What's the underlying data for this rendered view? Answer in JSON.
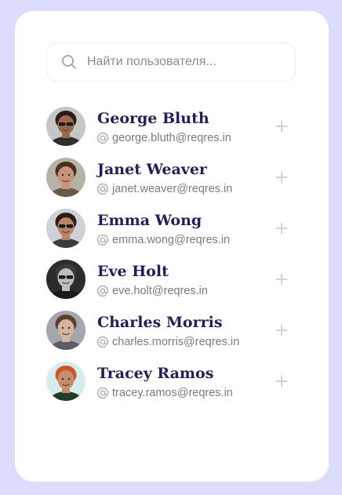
{
  "search": {
    "placeholder": "Найти пользователя..."
  },
  "users": [
    {
      "name": "George Bluth",
      "email": "george.bluth@reqres.in",
      "skin": "#9a6a4c",
      "hair": "#2a1d17",
      "bg": "#c6c6c6",
      "shirt": "#2f2f2f",
      "glasses": true
    },
    {
      "name": "Janet Weaver",
      "email": "janet.weaver@reqres.in",
      "skin": "#c99478",
      "hair": "#4a2f1e",
      "bg": "#b5b2a8",
      "shirt": "#6b5846",
      "glasses": false
    },
    {
      "name": "Emma Wong",
      "email": "emma.wong@reqres.in",
      "skin": "#b88469",
      "hair": "#2b1e18",
      "bg": "#cfd1d6",
      "shirt": "#3a3a3a",
      "glasses": true
    },
    {
      "name": "Eve Holt",
      "email": "eve.holt@reqres.in",
      "skin": "#bdbdbd",
      "hair": "#3a3a3a",
      "bg": "#2c2c2c",
      "shirt": "#1a1a1a",
      "glasses": true
    },
    {
      "name": "Charles Morris",
      "email": "charles.morris@reqres.in",
      "skin": "#d5b4a0",
      "hair": "#5b4030",
      "bg": "#a4a6ae",
      "shirt": "#5c5e66",
      "glasses": false
    },
    {
      "name": "Tracey Ramos",
      "email": "tracey.ramos@reqres.in",
      "skin": "#c88d6b",
      "hair": "#c9572c",
      "bg": "#d7ecec",
      "shirt": "#1f3b2a",
      "glasses": false
    }
  ],
  "colors": {
    "page_background": "#dcdcfd",
    "card_background": "#ffffff",
    "name_text": "#221e57",
    "email_text": "#7a7a80",
    "icon_muted": "#b0b0b6",
    "add_icon": "#d2d2d8"
  },
  "icons": {
    "search": "search-icon",
    "email": "at-icon",
    "add": "plus-icon"
  }
}
